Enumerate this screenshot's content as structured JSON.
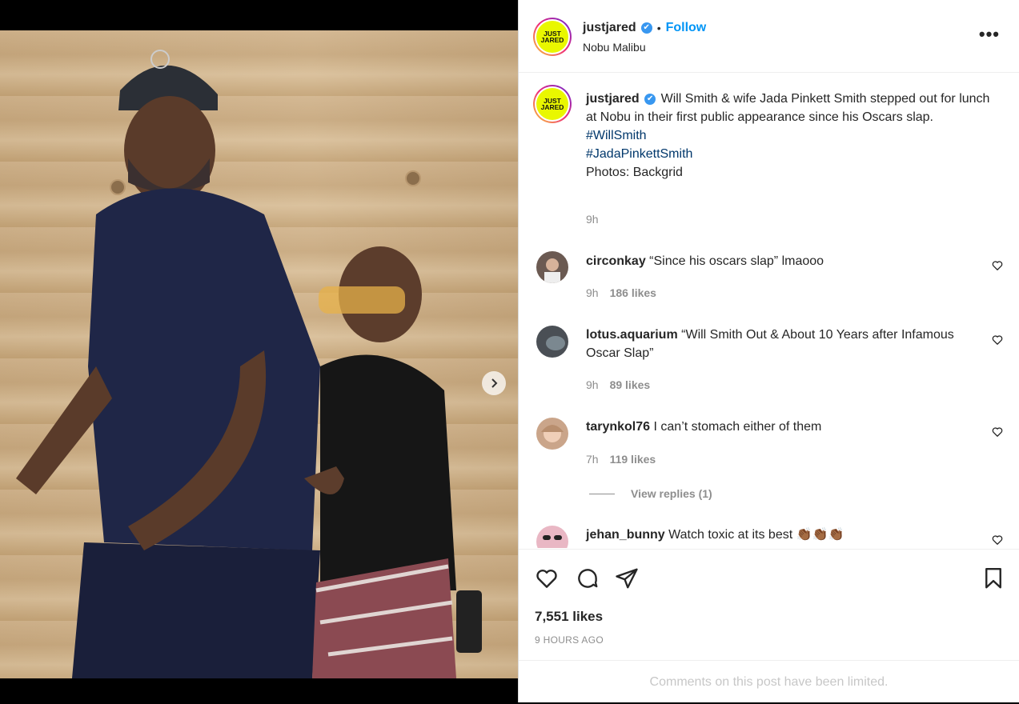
{
  "post": {
    "author": "justjared",
    "follow_label": "Follow",
    "separator": "•",
    "location": "Nobu Malibu",
    "avatar_text_top": "JUST",
    "avatar_text_bottom": "JARED",
    "verified_glyph": "✔",
    "more_glyph": "•••"
  },
  "caption": {
    "username": "justjared",
    "text": "Will Smith & wife Jada Pinkett Smith stepped out for lunch at Nobu in their first public appearance since his Oscars slap.",
    "hashtags": [
      "#WillSmith",
      "#JadaPinkettSmith"
    ],
    "credit": "Photos: Backgrid",
    "time": "9h"
  },
  "comments": [
    {
      "username": "circonkay",
      "text": "“Since his oscars slap” lmaooo",
      "time": "9h",
      "likes": "186 likes",
      "avatar_color": "#6b5a52"
    },
    {
      "username": "lotus.aquarium",
      "text": "“Will Smith Out & About 10 Years after Infamous Oscar Slap”",
      "time": "9h",
      "likes": "89 likes",
      "avatar_color": "#4a4f55"
    },
    {
      "username": "tarynkol76",
      "text": "I can’t stomach either of them",
      "time": "7h",
      "likes": "119 likes",
      "avatar_color": "#caa58a"
    },
    {
      "username": "jehan_bunny",
      "text": "Watch toxic at its best 👏🏾👏🏾👏🏾",
      "avatar_color": "#e9b7c4"
    }
  ],
  "view_replies": "View replies (1)",
  "engagement": {
    "likes": "7,551 likes",
    "posted_ago": "9 HOURS AGO",
    "comments_limited": "Comments on this post have been limited."
  },
  "colors": {
    "accent_blue": "#0095f6",
    "hashtag": "#00376b",
    "secondary_text": "#8e8e8e",
    "brand_logo_yellow": "#e9f700"
  },
  "icons": [
    "chevron-right-icon",
    "verified-icon",
    "more-options-icon",
    "heart-icon",
    "comment-icon",
    "share-icon",
    "bookmark-icon"
  ]
}
